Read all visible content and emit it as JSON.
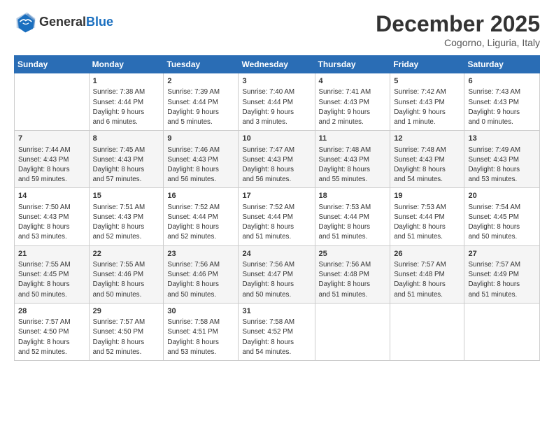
{
  "logo": {
    "line1": "General",
    "line2": "Blue"
  },
  "title": "December 2025",
  "location": "Cogorno, Liguria, Italy",
  "days_header": [
    "Sunday",
    "Monday",
    "Tuesday",
    "Wednesday",
    "Thursday",
    "Friday",
    "Saturday"
  ],
  "weeks": [
    [
      {
        "day": "",
        "info": ""
      },
      {
        "day": "1",
        "info": "Sunrise: 7:38 AM\nSunset: 4:44 PM\nDaylight: 9 hours\nand 6 minutes."
      },
      {
        "day": "2",
        "info": "Sunrise: 7:39 AM\nSunset: 4:44 PM\nDaylight: 9 hours\nand 5 minutes."
      },
      {
        "day": "3",
        "info": "Sunrise: 7:40 AM\nSunset: 4:44 PM\nDaylight: 9 hours\nand 3 minutes."
      },
      {
        "day": "4",
        "info": "Sunrise: 7:41 AM\nSunset: 4:43 PM\nDaylight: 9 hours\nand 2 minutes."
      },
      {
        "day": "5",
        "info": "Sunrise: 7:42 AM\nSunset: 4:43 PM\nDaylight: 9 hours\nand 1 minute."
      },
      {
        "day": "6",
        "info": "Sunrise: 7:43 AM\nSunset: 4:43 PM\nDaylight: 9 hours\nand 0 minutes."
      }
    ],
    [
      {
        "day": "7",
        "info": "Sunrise: 7:44 AM\nSunset: 4:43 PM\nDaylight: 8 hours\nand 59 minutes."
      },
      {
        "day": "8",
        "info": "Sunrise: 7:45 AM\nSunset: 4:43 PM\nDaylight: 8 hours\nand 57 minutes."
      },
      {
        "day": "9",
        "info": "Sunrise: 7:46 AM\nSunset: 4:43 PM\nDaylight: 8 hours\nand 56 minutes."
      },
      {
        "day": "10",
        "info": "Sunrise: 7:47 AM\nSunset: 4:43 PM\nDaylight: 8 hours\nand 56 minutes."
      },
      {
        "day": "11",
        "info": "Sunrise: 7:48 AM\nSunset: 4:43 PM\nDaylight: 8 hours\nand 55 minutes."
      },
      {
        "day": "12",
        "info": "Sunrise: 7:48 AM\nSunset: 4:43 PM\nDaylight: 8 hours\nand 54 minutes."
      },
      {
        "day": "13",
        "info": "Sunrise: 7:49 AM\nSunset: 4:43 PM\nDaylight: 8 hours\nand 53 minutes."
      }
    ],
    [
      {
        "day": "14",
        "info": "Sunrise: 7:50 AM\nSunset: 4:43 PM\nDaylight: 8 hours\nand 53 minutes."
      },
      {
        "day": "15",
        "info": "Sunrise: 7:51 AM\nSunset: 4:43 PM\nDaylight: 8 hours\nand 52 minutes."
      },
      {
        "day": "16",
        "info": "Sunrise: 7:52 AM\nSunset: 4:44 PM\nDaylight: 8 hours\nand 52 minutes."
      },
      {
        "day": "17",
        "info": "Sunrise: 7:52 AM\nSunset: 4:44 PM\nDaylight: 8 hours\nand 51 minutes."
      },
      {
        "day": "18",
        "info": "Sunrise: 7:53 AM\nSunset: 4:44 PM\nDaylight: 8 hours\nand 51 minutes."
      },
      {
        "day": "19",
        "info": "Sunrise: 7:53 AM\nSunset: 4:44 PM\nDaylight: 8 hours\nand 51 minutes."
      },
      {
        "day": "20",
        "info": "Sunrise: 7:54 AM\nSunset: 4:45 PM\nDaylight: 8 hours\nand 50 minutes."
      }
    ],
    [
      {
        "day": "21",
        "info": "Sunrise: 7:55 AM\nSunset: 4:45 PM\nDaylight: 8 hours\nand 50 minutes."
      },
      {
        "day": "22",
        "info": "Sunrise: 7:55 AM\nSunset: 4:46 PM\nDaylight: 8 hours\nand 50 minutes."
      },
      {
        "day": "23",
        "info": "Sunrise: 7:56 AM\nSunset: 4:46 PM\nDaylight: 8 hours\nand 50 minutes."
      },
      {
        "day": "24",
        "info": "Sunrise: 7:56 AM\nSunset: 4:47 PM\nDaylight: 8 hours\nand 50 minutes."
      },
      {
        "day": "25",
        "info": "Sunrise: 7:56 AM\nSunset: 4:48 PM\nDaylight: 8 hours\nand 51 minutes."
      },
      {
        "day": "26",
        "info": "Sunrise: 7:57 AM\nSunset: 4:48 PM\nDaylight: 8 hours\nand 51 minutes."
      },
      {
        "day": "27",
        "info": "Sunrise: 7:57 AM\nSunset: 4:49 PM\nDaylight: 8 hours\nand 51 minutes."
      }
    ],
    [
      {
        "day": "28",
        "info": "Sunrise: 7:57 AM\nSunset: 4:50 PM\nDaylight: 8 hours\nand 52 minutes."
      },
      {
        "day": "29",
        "info": "Sunrise: 7:57 AM\nSunset: 4:50 PM\nDaylight: 8 hours\nand 52 minutes."
      },
      {
        "day": "30",
        "info": "Sunrise: 7:58 AM\nSunset: 4:51 PM\nDaylight: 8 hours\nand 53 minutes."
      },
      {
        "day": "31",
        "info": "Sunrise: 7:58 AM\nSunset: 4:52 PM\nDaylight: 8 hours\nand 54 minutes."
      },
      {
        "day": "",
        "info": ""
      },
      {
        "day": "",
        "info": ""
      },
      {
        "day": "",
        "info": ""
      }
    ]
  ]
}
